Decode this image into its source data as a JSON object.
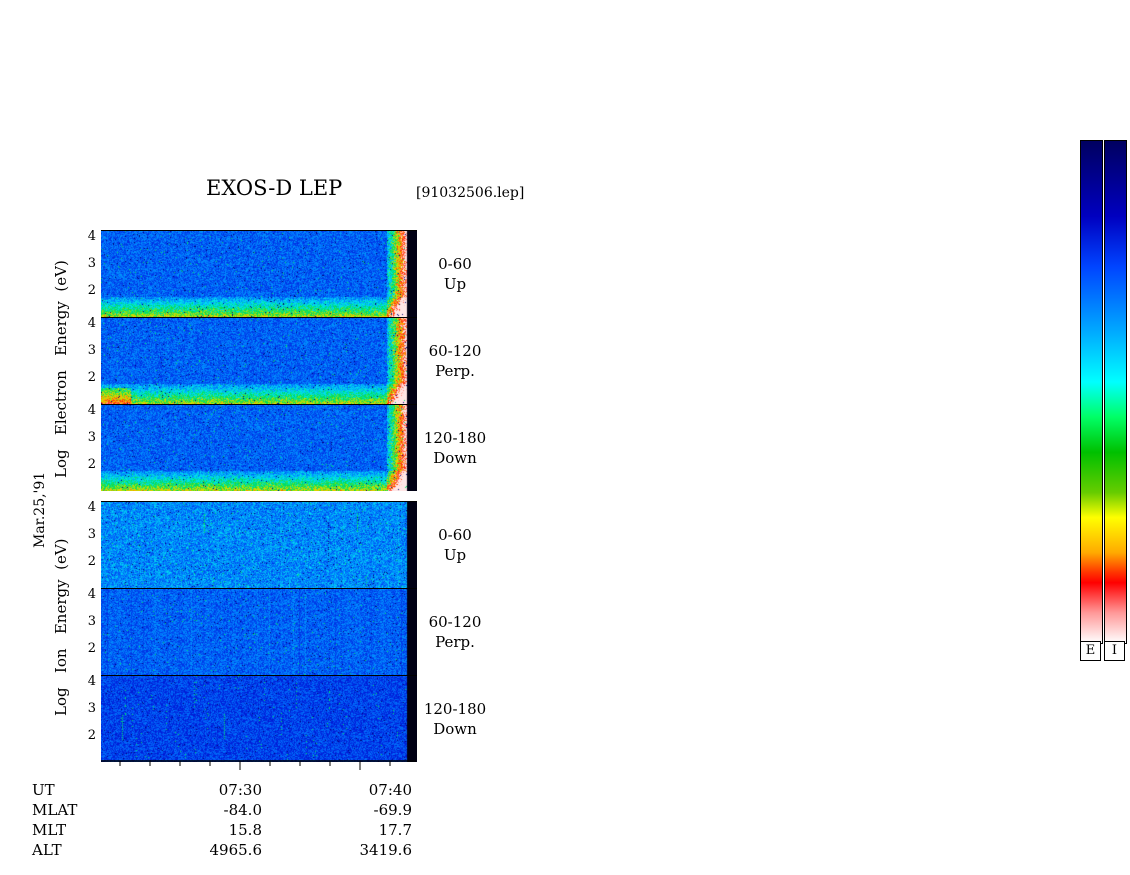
{
  "title": "EXOS-D LEP",
  "file": "[91032506.lep]",
  "date_label": "Mar.25,'91",
  "electron_axis_label": [
    "Log",
    "Electron",
    "Energy",
    "(eV)"
  ],
  "ion_axis_label": [
    "Log",
    "Ion",
    "Energy",
    "(eV)"
  ],
  "panels": [
    {
      "species": "electron",
      "range": "0-60",
      "dir": "Up"
    },
    {
      "species": "electron",
      "range": "60-120",
      "dir": "Perp."
    },
    {
      "species": "electron",
      "range": "120-180",
      "dir": "Down"
    },
    {
      "species": "ion",
      "range": "0-60",
      "dir": "Up"
    },
    {
      "species": "ion",
      "range": "60-120",
      "dir": "Perp."
    },
    {
      "species": "ion",
      "range": "120-180",
      "dir": "Down"
    }
  ],
  "y_ticks": [
    "4",
    "3",
    "2"
  ],
  "footer": {
    "labels": [
      "UT",
      "MLAT",
      "MLT",
      "ALT"
    ],
    "col1": [
      "07:30",
      "-84.0",
      "15.8",
      "4965.6"
    ],
    "col2": [
      "07:40",
      "-69.9",
      "17.7",
      "3419.6"
    ]
  },
  "colorbar_labels": [
    "E",
    "I"
  ],
  "chart_data": {
    "type": "heatmap",
    "title": "EXOS-D LEP",
    "xlabel": "UT",
    "ylabel": "Log Energy (eV)",
    "ylim": [
      1,
      4
    ],
    "x_ticks": [
      "07:30",
      "07:40"
    ],
    "series": [
      {
        "name": "Electron 0-60 Up"
      },
      {
        "name": "Electron 60-120 Perp."
      },
      {
        "name": "Electron 120-180 Down"
      },
      {
        "name": "Ion 0-60 Up"
      },
      {
        "name": "Ion 60-120 Perp."
      },
      {
        "name": "Ion 120-180 Down"
      }
    ],
    "colorscale": [
      "#ffffff",
      "#ff0000",
      "#ffa500",
      "#ffff00",
      "#00c000",
      "#00ffff",
      "#0000ff",
      "#000066"
    ]
  }
}
